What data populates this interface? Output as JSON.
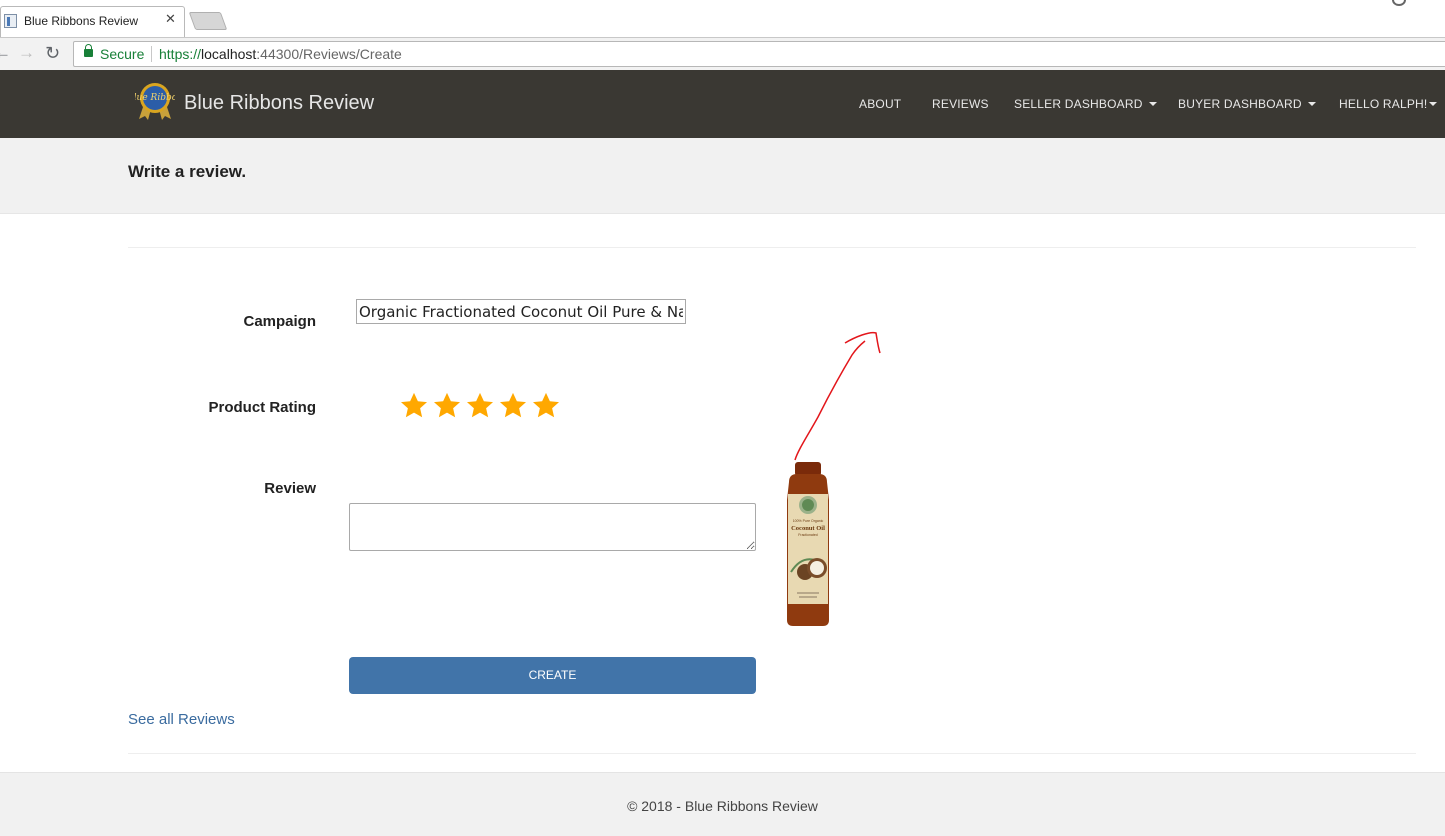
{
  "browser": {
    "tab_title": "Blue Ribbons Review",
    "tab_close": "✕",
    "secure_label": "Secure",
    "url_scheme": "https://",
    "url_host": "localhost",
    "url_rest": ":44300/Reviews/Create"
  },
  "navbar": {
    "brand": "Blue Ribbons Review",
    "logo_text": "Blue Ribbon",
    "items": [
      {
        "label": "ABOUT",
        "dropdown": false
      },
      {
        "label": "REVIEWS",
        "dropdown": false
      },
      {
        "label": "SELLER DASHBOARD",
        "dropdown": true
      },
      {
        "label": "BUYER DASHBOARD",
        "dropdown": true
      },
      {
        "label": "HELLO RALPH!",
        "dropdown": true
      }
    ]
  },
  "page": {
    "title": "Write a review."
  },
  "form": {
    "campaign_label": "Campaign",
    "campaign_value": "Organic Fractionated Coconut Oil Pure & Natural",
    "rating_label": "Product Rating",
    "rating_value": 5,
    "rating_max": 5,
    "star_color": "#ffa800",
    "review_label": "Review",
    "review_value": "",
    "create_label": "CREATE"
  },
  "product_image": {
    "label_line1": "100% Pure Organic",
    "label_line2": "Coconut Oil",
    "label_line3": "Fractionated"
  },
  "links": {
    "see_all": "See all Reviews"
  },
  "footer": {
    "text": "© 2018 - Blue Ribbons Review"
  },
  "colors": {
    "navbar_bg": "#3a3833",
    "accent": "#4174a9",
    "secure_green": "#188038"
  }
}
